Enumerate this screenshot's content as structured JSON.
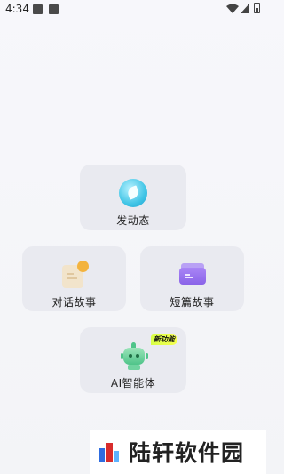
{
  "status_bar": {
    "time": "4:34"
  },
  "cards": {
    "post": {
      "label": "发动态",
      "icon": "leaf-bubble-icon"
    },
    "dialog_story": {
      "label": "对话故事",
      "icon": "note-sun-icon"
    },
    "short_story": {
      "label": "短篇故事",
      "icon": "folder-book-icon"
    },
    "ai_agent": {
      "label": "AI智能体",
      "icon": "robot-icon",
      "badge": "新功能"
    }
  },
  "watermark": {
    "text": "陆轩软件园"
  },
  "colors": {
    "card_bg": "#e9eaf0",
    "badge": "#e4ff4a",
    "robot": "#4fc489",
    "book": "#8a63e8",
    "sun": "#f3b33e",
    "leaf": "#41c5e6"
  }
}
